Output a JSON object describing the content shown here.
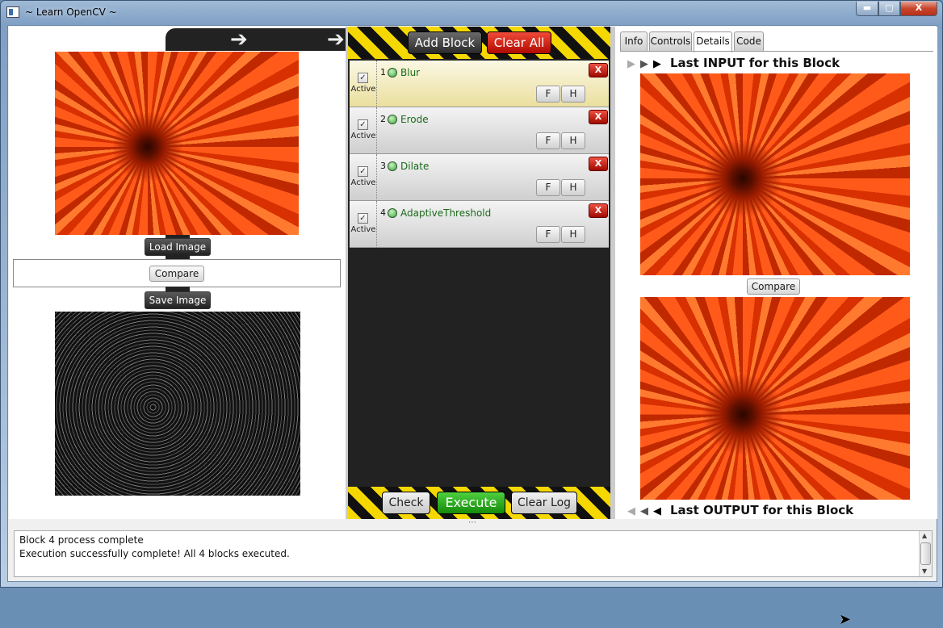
{
  "window": {
    "title": "~ Learn OpenCV ~",
    "min": "▬",
    "max": "▢",
    "close": "X"
  },
  "left": {
    "arrow": "➔",
    "load_label": "Load Image",
    "compare_label": "Compare",
    "save_label": "Save Image"
  },
  "middle": {
    "add_block": "Add Block",
    "clear_all": "Clear All",
    "check": "Check",
    "execute": "Execute",
    "clear_log": "Clear Log",
    "blocks": [
      {
        "num": "1",
        "name": "Blur",
        "active_label": "Active",
        "checked": "✓",
        "remove": "X",
        "f": "F",
        "h": "H"
      },
      {
        "num": "2",
        "name": "Erode",
        "active_label": "Active",
        "checked": "✓",
        "remove": "X",
        "f": "F",
        "h": "H"
      },
      {
        "num": "3",
        "name": "Dilate",
        "active_label": "Active",
        "checked": "✓",
        "remove": "X",
        "f": "F",
        "h": "H"
      },
      {
        "num": "4",
        "name": "AdaptiveThreshold",
        "active_label": "Active",
        "checked": "✓",
        "remove": "X",
        "f": "F",
        "h": "H"
      }
    ]
  },
  "right": {
    "tabs": [
      "Info",
      "Controls",
      "Details",
      "Code"
    ],
    "active_tab": "Details",
    "input_label": "Last INPUT for this Block",
    "output_label": "Last OUTPUT for this Block",
    "compare_label": "Compare"
  },
  "log": {
    "line1": "Block 4 process complete",
    "line2": "Execution successfully complete! All 4 blocks executed."
  },
  "colors": {
    "accent_red": "#c00a00",
    "execute_green": "#1a9a10",
    "hazard_yellow": "#f5d800",
    "block_name": "#1a6a1a"
  }
}
